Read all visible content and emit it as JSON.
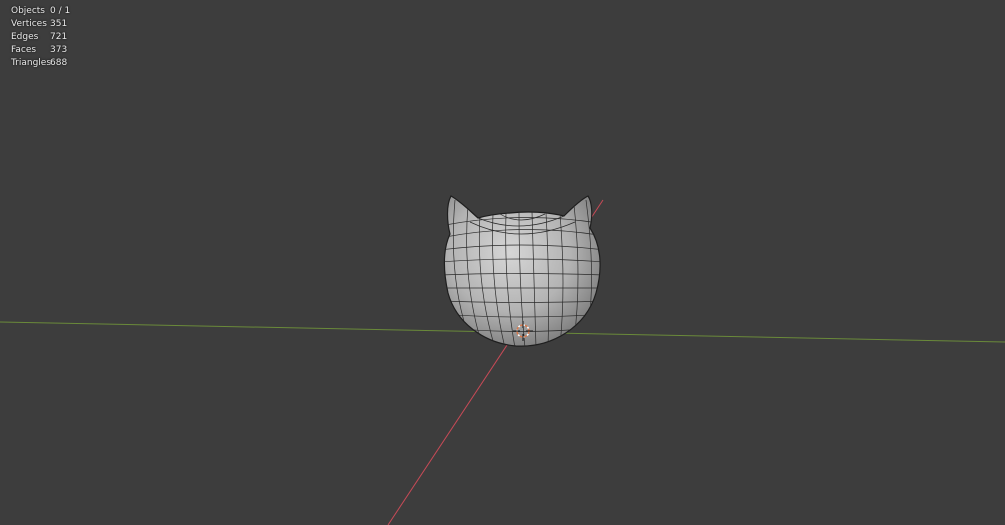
{
  "stats": [
    {
      "label": "Objects",
      "value": "0 / 1"
    },
    {
      "label": "Vertices",
      "value": "351"
    },
    {
      "label": "Edges",
      "value": "721"
    },
    {
      "label": "Faces",
      "value": "373"
    },
    {
      "label": "Triangles",
      "value": "688"
    }
  ],
  "colors": {
    "background": "#3d3d3d",
    "x_axis": "#c84a57",
    "y_axis": "#6a8a3a",
    "mesh_fill": "#b9b9b9",
    "wire": "#1e1e1e",
    "cursor": "#d9784a"
  },
  "icons": {
    "cursor": "3d-cursor-icon"
  }
}
